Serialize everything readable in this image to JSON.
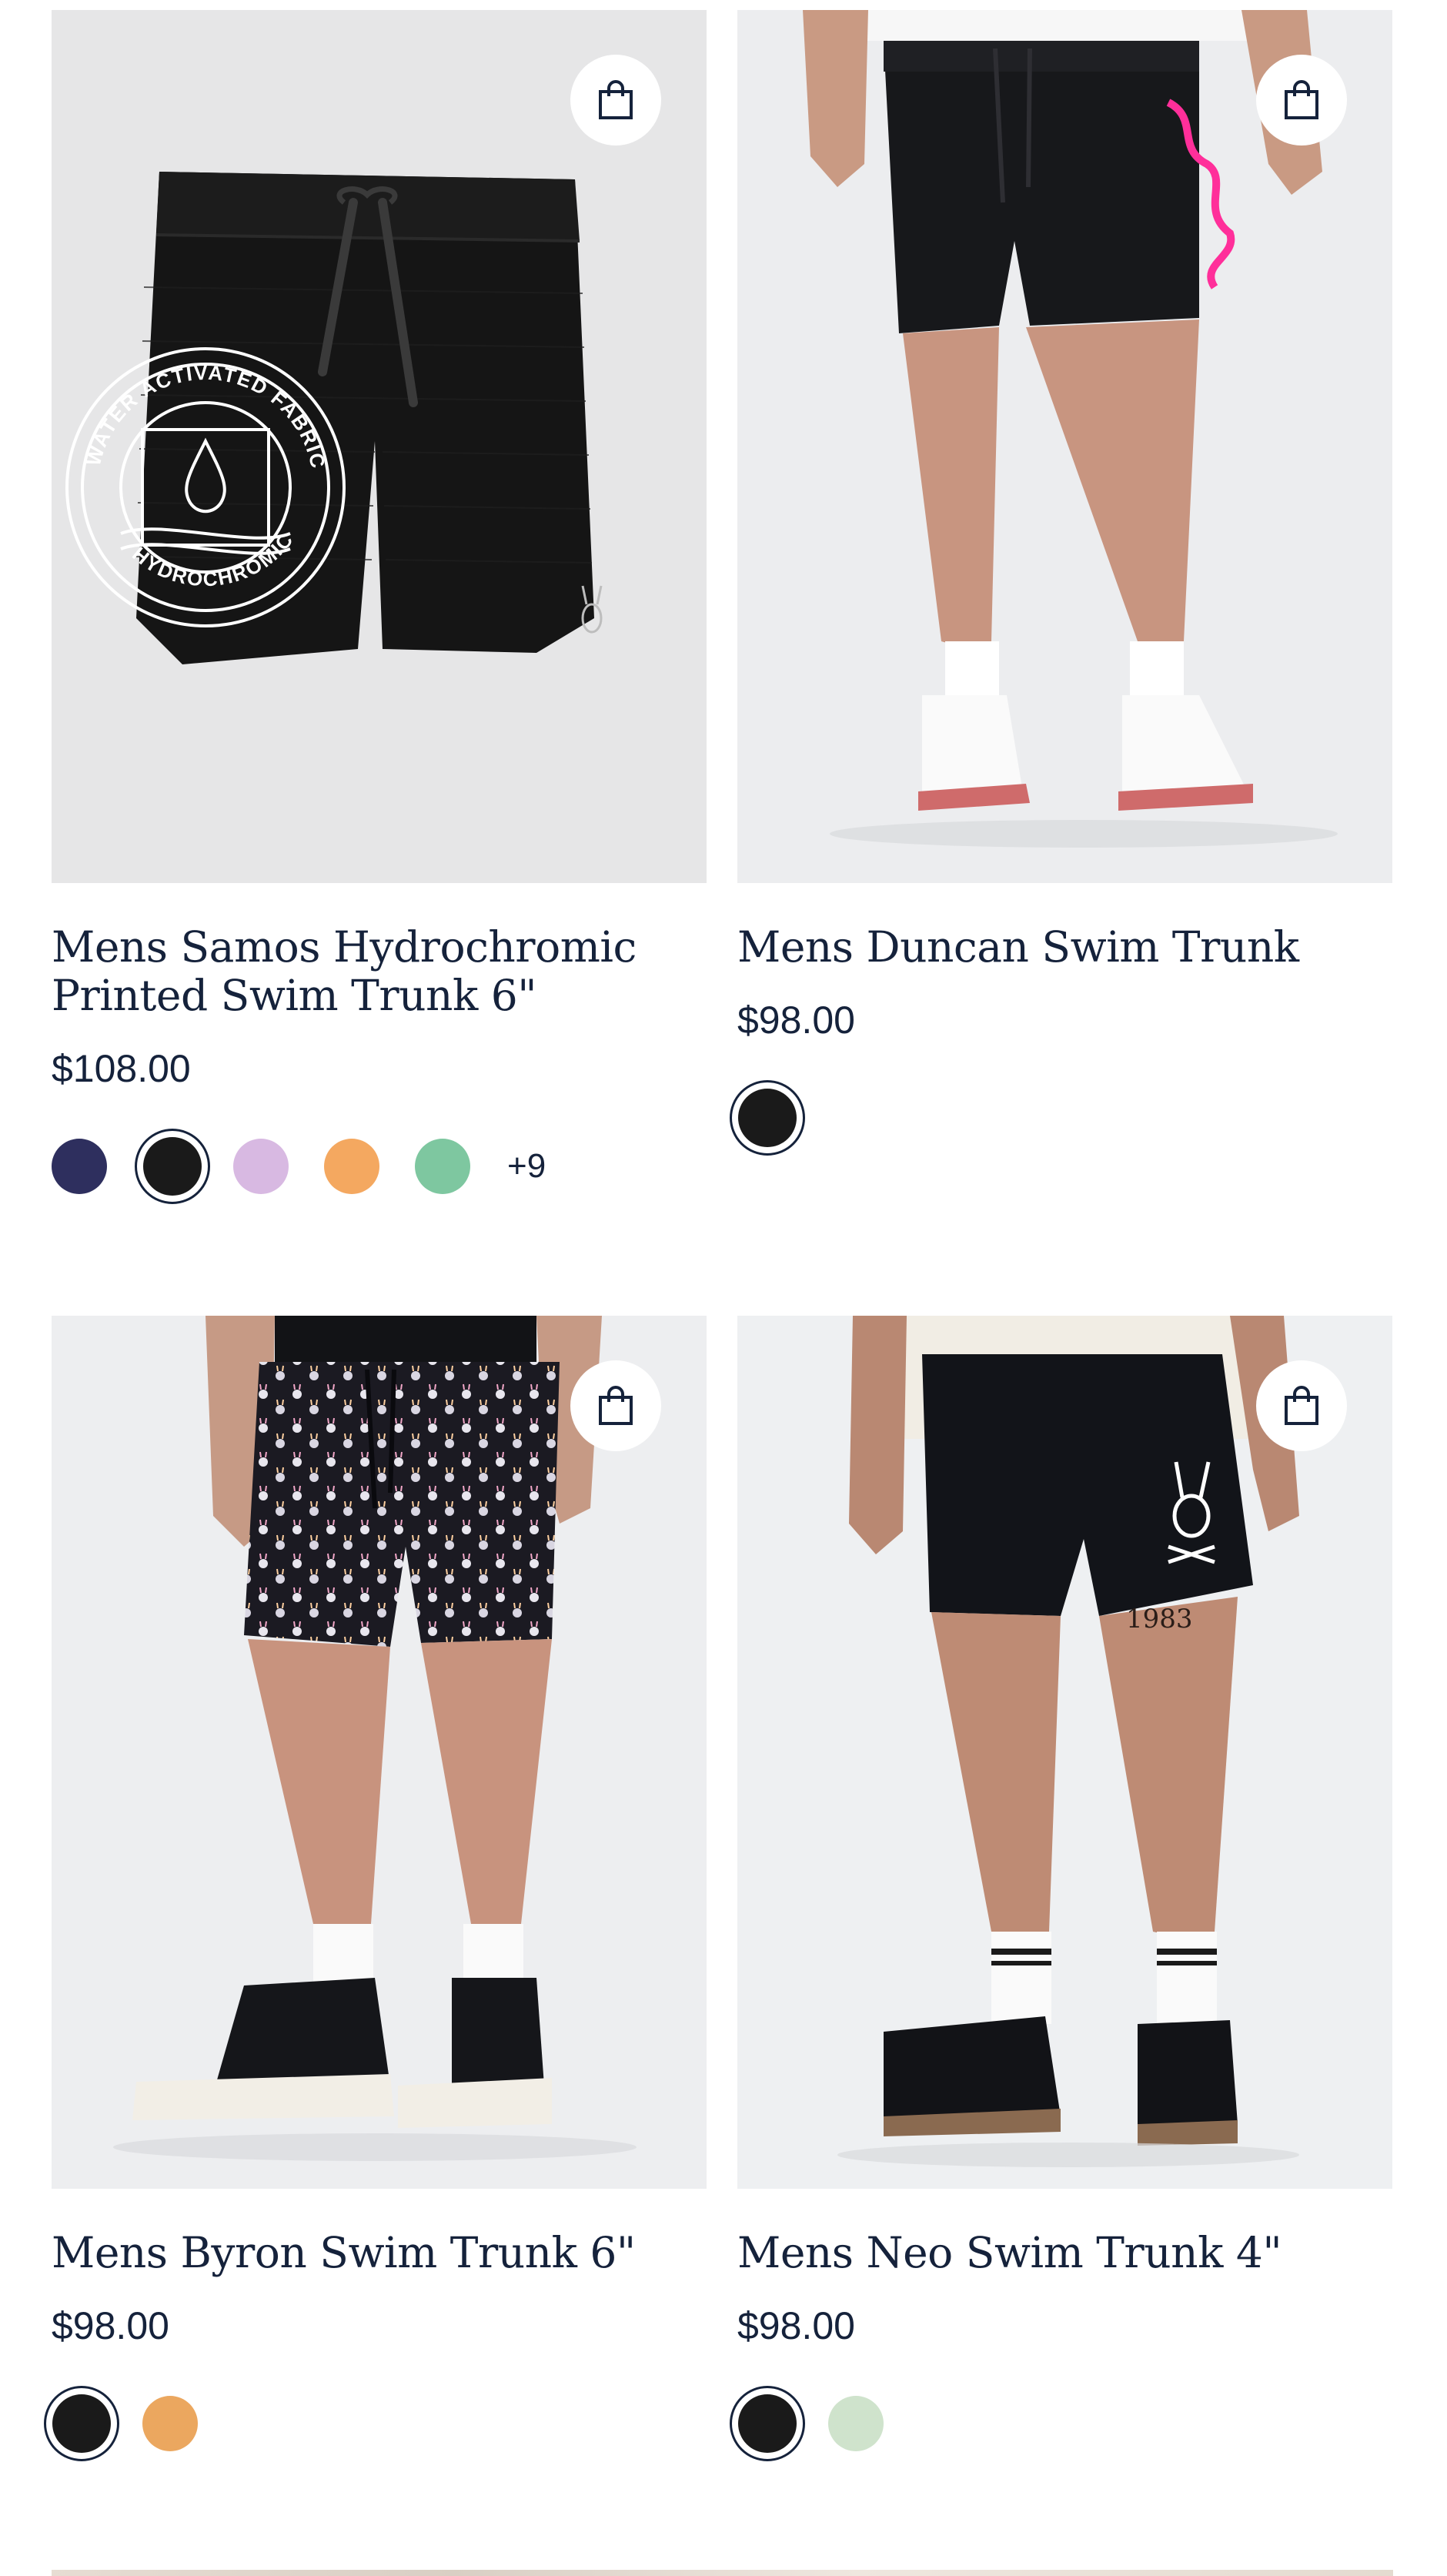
{
  "products": [
    {
      "title_lines": [
        "Mens Samos Hydrochromic",
        "Printed Swim Trunk 6\""
      ],
      "price": "$108.00",
      "badge_text": [
        "WATER ACTIVATED FABRIC",
        "HYDROCHROMIC"
      ],
      "bag_icon": "shopping-bag-icon",
      "swatches": [
        {
          "color": "#2e2f5e",
          "selected": false
        },
        {
          "color": "#1a1a1a",
          "selected": true
        },
        {
          "color": "#d8b9e2",
          "selected": false
        },
        {
          "color": "#f4a860",
          "selected": false
        },
        {
          "color": "#7ec7a0",
          "selected": false
        }
      ],
      "more_colors": "+9"
    },
    {
      "title_lines": [
        "Mens Duncan Swim Trunk"
      ],
      "price": "$98.00",
      "bag_icon": "shopping-bag-icon",
      "swatches": [
        {
          "color": "#1a1a1a",
          "selected": true
        }
      ]
    },
    {
      "title_lines": [
        "Mens Byron Swim Trunk 6\""
      ],
      "price": "$98.00",
      "bag_icon": "shopping-bag-icon",
      "swatches": [
        {
          "color": "#1a1a1a",
          "selected": true
        },
        {
          "color": "#eba75f",
          "selected": false
        }
      ]
    },
    {
      "title_lines": [
        "Mens Neo Swim Trunk 4\""
      ],
      "price": "$98.00",
      "tattoo_text": "1983",
      "bag_icon": "shopping-bag-icon",
      "swatches": [
        {
          "color": "#1a1a1a",
          "selected": true
        },
        {
          "color": "#cfe3cc",
          "selected": false
        }
      ]
    }
  ],
  "colors": {
    "text": "#15223b",
    "image_bg": "#e8e8e9",
    "image_bg_light": "#eef0f1"
  }
}
